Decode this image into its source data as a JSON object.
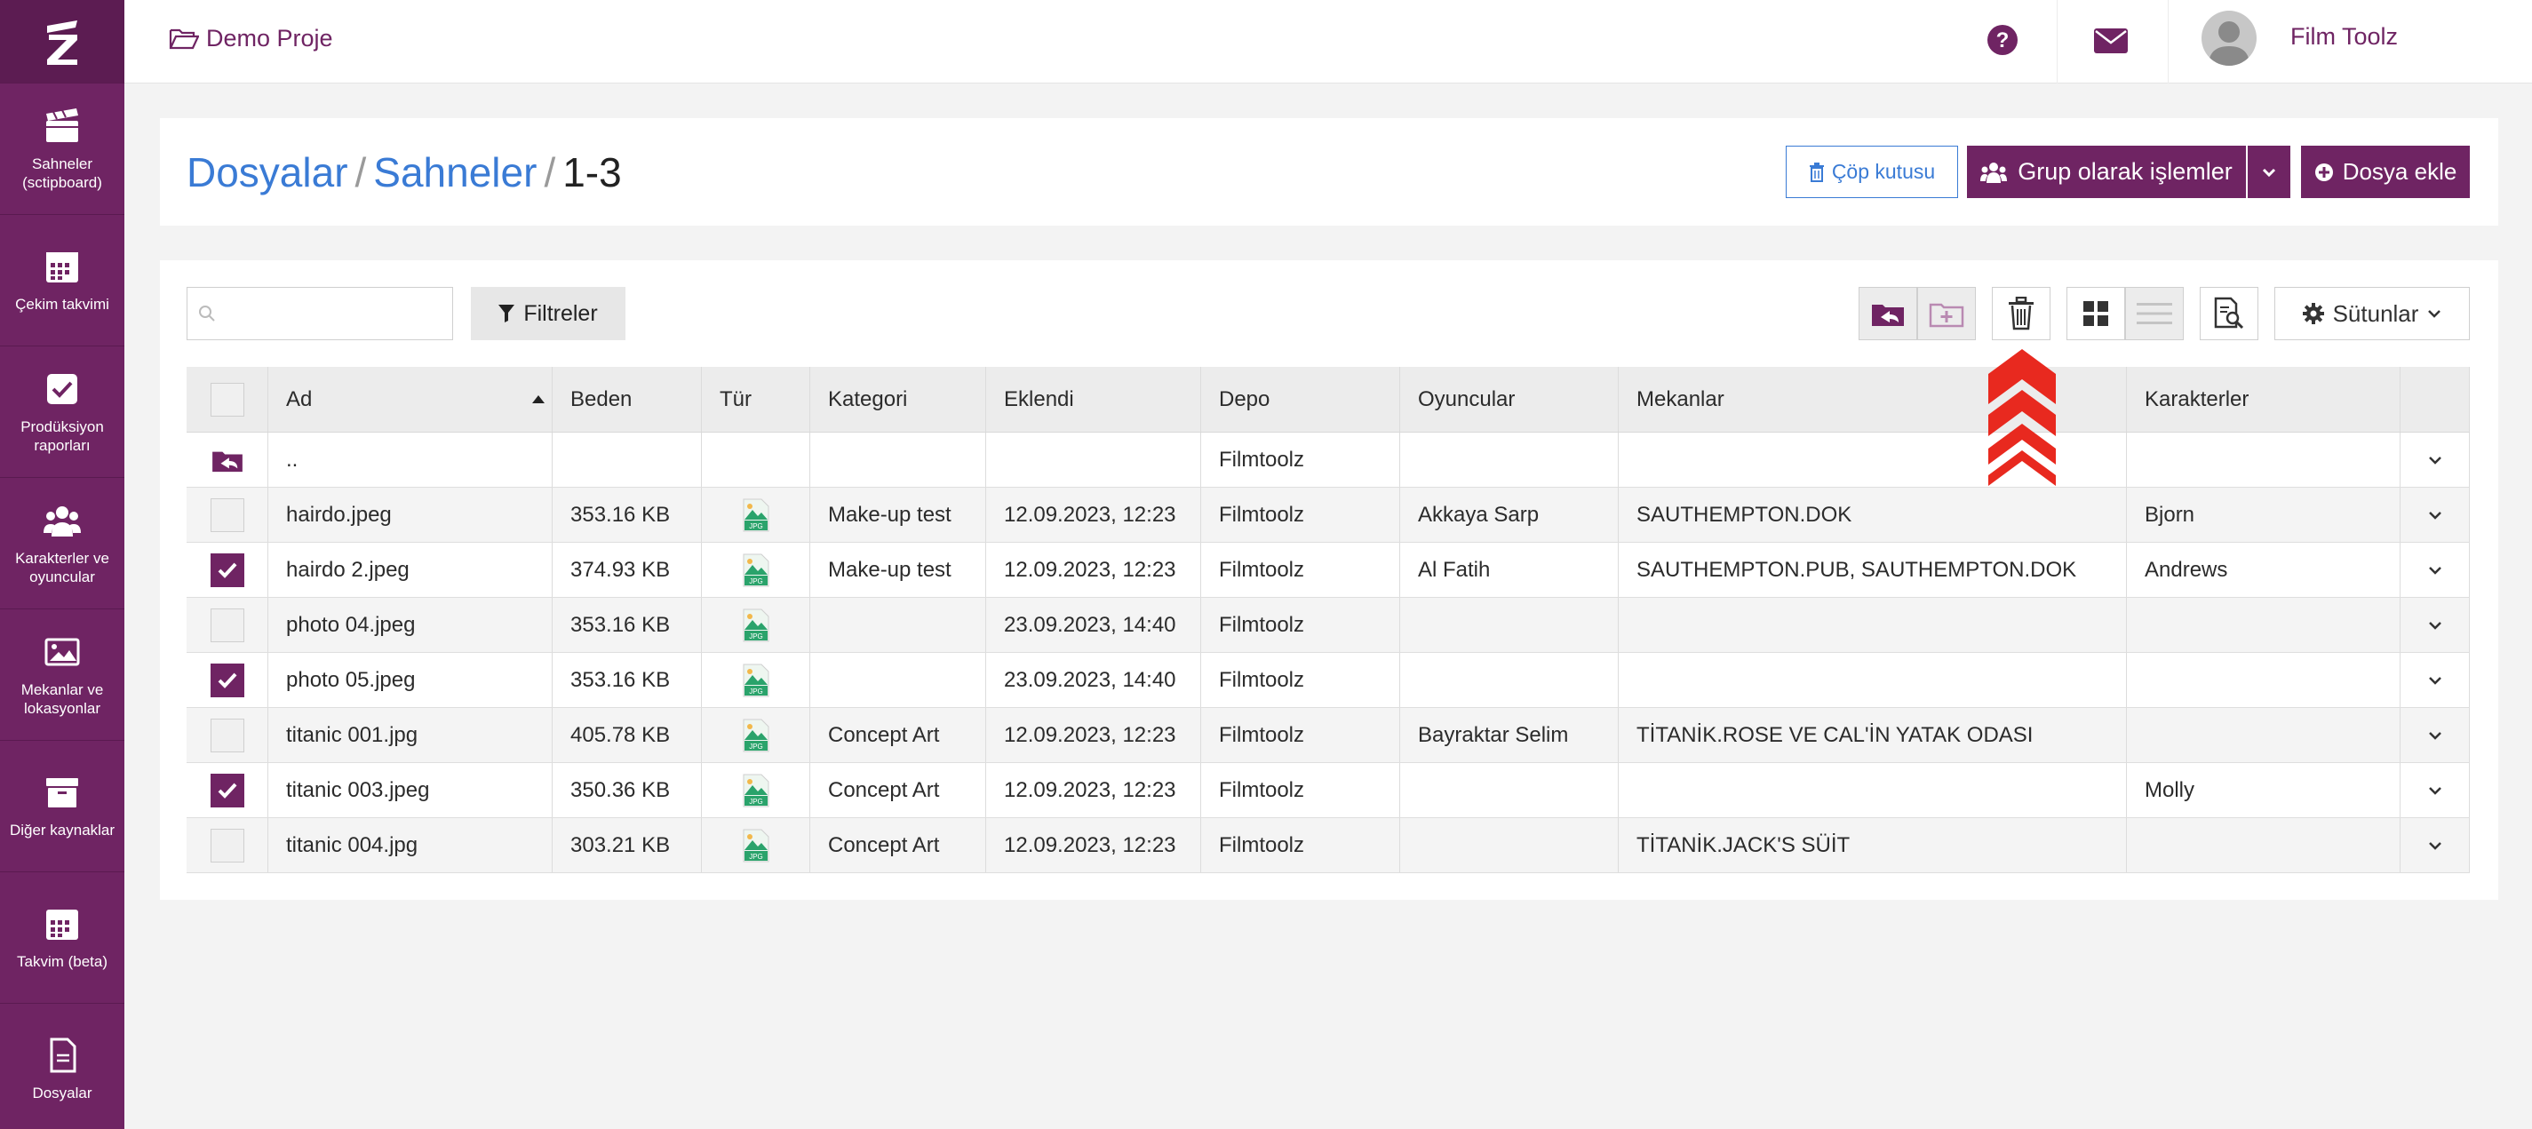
{
  "sidebar": {
    "items": [
      {
        "label": "Sahneler (sctipboard)",
        "icon": "clapperboard-icon"
      },
      {
        "label": "Çekim takvimi",
        "icon": "calendar-icon"
      },
      {
        "label": "Prodüksiyon raporları",
        "icon": "checkbox-icon"
      },
      {
        "label": "Karakterler ve oyuncular",
        "icon": "users-icon"
      },
      {
        "label": "Mekanlar ve lokasyonlar",
        "icon": "image-icon"
      },
      {
        "label": "Diğer kaynaklar",
        "icon": "archive-icon"
      },
      {
        "label": "Takvim (beta)",
        "icon": "calendar-icon"
      },
      {
        "label": "Dosyalar",
        "icon": "file-icon"
      }
    ]
  },
  "header": {
    "project": "Demo Proje",
    "user_name": "Film Toolz",
    "lang": "TR"
  },
  "breadcrumb": {
    "part1": "Dosyalar",
    "part2": "Sahneler",
    "current": "1-3",
    "sep": "/"
  },
  "actions": {
    "trash_label": "Çöp kutusu",
    "group_label": "Grup olarak işlemler",
    "add_label": "Dosya ekle"
  },
  "toolbar": {
    "filter_label": "Filtreler",
    "columns_label": "Sütunlar",
    "search_placeholder": ""
  },
  "table": {
    "headers": [
      "Ad",
      "Beden",
      "Tür",
      "Kategori",
      "Eklendi",
      "Depo",
      "Oyuncular",
      "Mekanlar",
      "Karakterler"
    ],
    "parent_row": {
      "name": "..",
      "depo": "Filmtoolz"
    },
    "rows": [
      {
        "name": "hairdo.jpeg",
        "size": "353.16 KB",
        "type_label": "JPG",
        "category": "Make-up test",
        "added": "12.09.2023, 12:23",
        "depo": "Filmtoolz",
        "actors": "Akkaya Sarp",
        "locations": "SAUTHEMPTON.DOK",
        "characters": "Bjorn",
        "checked": false
      },
      {
        "name": "hairdo 2.jpeg",
        "size": "374.93 KB",
        "type_label": "JPG",
        "category": "Make-up test",
        "added": "12.09.2023, 12:23",
        "depo": "Filmtoolz",
        "actors": "Al Fatih",
        "locations": "SAUTHEMPTON.PUB, SAUTHEMPTON.DOK",
        "characters": "Andrews",
        "checked": true
      },
      {
        "name": "photo 04.jpeg",
        "size": "353.16 KB",
        "type_label": "JPG",
        "category": "",
        "added": "23.09.2023, 14:40",
        "depo": "Filmtoolz",
        "actors": "",
        "locations": "",
        "characters": "",
        "checked": false
      },
      {
        "name": "photo 05.jpeg",
        "size": "353.16 KB",
        "type_label": "JPG",
        "category": "",
        "added": "23.09.2023, 14:40",
        "depo": "Filmtoolz",
        "actors": "",
        "locations": "",
        "characters": "",
        "checked": true
      },
      {
        "name": "titanic 001.jpg",
        "size": "405.78 KB",
        "type_label": "JPG",
        "category": "Concept Art",
        "added": "12.09.2023, 12:23",
        "depo": "Filmtoolz",
        "actors": "Bayraktar Selim",
        "locations": "TİTANİK.ROSE VE CAL'İN YATAK ODASI",
        "characters": "",
        "checked": false
      },
      {
        "name": "titanic 003.jpeg",
        "size": "350.36 KB",
        "type_label": "JPG",
        "category": "Concept Art",
        "added": "12.09.2023, 12:23",
        "depo": "Filmtoolz",
        "actors": "",
        "locations": "",
        "characters": "Molly",
        "checked": true
      },
      {
        "name": "titanic 004.jpg",
        "size": "303.21 KB",
        "type_label": "JPG",
        "category": "Concept Art",
        "added": "12.09.2023, 12:23",
        "depo": "Filmtoolz",
        "actors": "",
        "locations": "TİTANİK.JACK'S SÜİT",
        "characters": "",
        "checked": false
      }
    ]
  },
  "colors": {
    "brand": "#6f2463",
    "link": "#3a7bd5",
    "annotation_arrow": "#e8291f"
  }
}
